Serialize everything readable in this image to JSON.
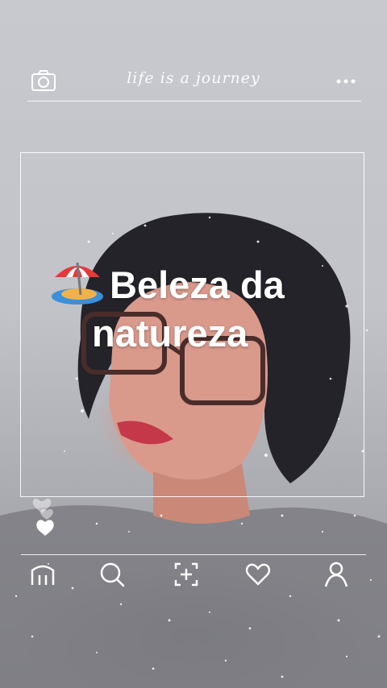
{
  "header": {
    "brand_text": "life is a journey",
    "camera_icon": "camera-icon",
    "more_icon": "more-dots-icon"
  },
  "caption": {
    "emoji_name": "beach-umbrella-emoji",
    "line1": "Beleza da",
    "line2": "natureza"
  },
  "overlay": {
    "hearts_icon": "hearts-icon"
  },
  "bottom_nav": {
    "items": [
      {
        "icon": "home-icon"
      },
      {
        "icon": "search-icon"
      },
      {
        "icon": "add-post-icon"
      },
      {
        "icon": "heart-icon"
      },
      {
        "icon": "profile-icon"
      }
    ]
  },
  "colors": {
    "overlay_line": "#ffffff",
    "background": "#c4c6cc"
  }
}
